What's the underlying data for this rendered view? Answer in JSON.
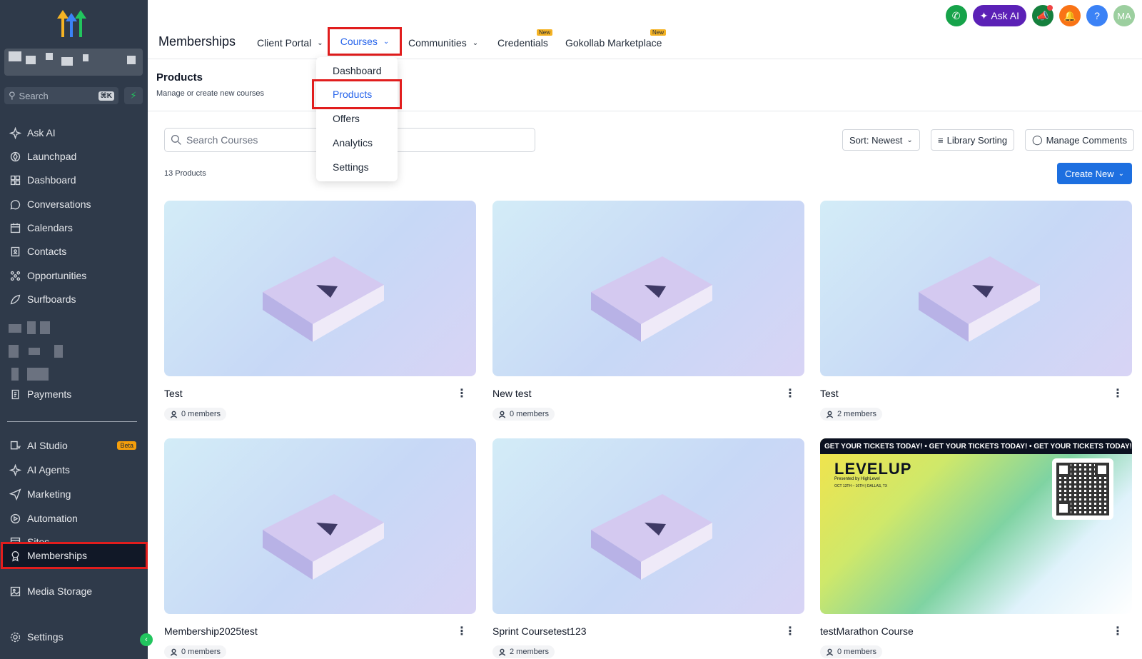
{
  "sidebar": {
    "search_placeholder": "Search",
    "search_shortcut": "⌘K",
    "items": [
      {
        "label": "Ask AI",
        "icon": "sparkle-icon"
      },
      {
        "label": "Launchpad",
        "icon": "rocket-icon"
      },
      {
        "label": "Dashboard",
        "icon": "grid-icon"
      },
      {
        "label": "Conversations",
        "icon": "chat-icon"
      },
      {
        "label": "Calendars",
        "icon": "calendar-icon"
      },
      {
        "label": "Contacts",
        "icon": "contacts-icon"
      },
      {
        "label": "Opportunities",
        "icon": "pipeline-icon"
      },
      {
        "label": "Surfboards",
        "icon": "surfboard-icon"
      },
      {
        "label": "Payments",
        "icon": "receipt-icon"
      },
      {
        "label": "AI Studio",
        "icon": "sparkle-icon",
        "badge": "Beta"
      },
      {
        "label": "AI Agents",
        "icon": "sparkle-icon"
      },
      {
        "label": "Marketing",
        "icon": "send-icon"
      },
      {
        "label": "Automation",
        "icon": "automation-icon"
      },
      {
        "label": "Sites",
        "icon": "sites-icon"
      },
      {
        "label": "Memberships",
        "icon": "award-icon"
      },
      {
        "label": "Media Storage",
        "icon": "image-icon"
      },
      {
        "label": "Settings",
        "icon": "gear-icon"
      }
    ]
  },
  "topbar": {
    "title": "Memberships",
    "tabs": [
      {
        "label": "Client Portal",
        "dropdown": true
      },
      {
        "label": "Courses",
        "dropdown": true
      },
      {
        "label": "Communities",
        "dropdown": true
      },
      {
        "label": "Credentials",
        "badge": "New"
      },
      {
        "label": "Gokollab Marketplace",
        "badge": "New"
      }
    ],
    "ask_ai": "Ask AI",
    "avatar_initials": "MA",
    "help": "?"
  },
  "dropdown": {
    "items": [
      "Dashboard",
      "Products",
      "Offers",
      "Analytics",
      "Settings"
    ],
    "active": "Products"
  },
  "page": {
    "title": "Products",
    "subtitle": "Manage or create new courses",
    "search_placeholder": "Search Courses",
    "sort_label": "Sort: Newest",
    "library_sorting": "Library Sorting",
    "manage_comments": "Manage Comments",
    "count": "13 Products",
    "create_new": "Create New"
  },
  "products": [
    {
      "title": "Test",
      "members": "0 members",
      "thumb": "book"
    },
    {
      "title": "New test",
      "members": "0 members",
      "thumb": "book"
    },
    {
      "title": "Test",
      "members": "2 members",
      "thumb": "book"
    },
    {
      "title": "Membership2025test",
      "members": "0 members",
      "thumb": "book"
    },
    {
      "title": "Sprint Coursetest123",
      "members": "2 members",
      "thumb": "book"
    },
    {
      "title": "testMarathon Course",
      "members": "0 members",
      "thumb": "levelup"
    }
  ],
  "promo": {
    "banner": "GET YOUR TICKETS TODAY! • GET YOUR TICKETS TODAY! • GET YOUR TICKETS TODAY!",
    "brand": "LEVELUP",
    "presented": "Presented by HighLevel",
    "date": "OCT 13TH – 16TH | DALLAS, TX"
  },
  "colors": {
    "accent": "#1d6fe0",
    "sidebar": "#2f3a4a",
    "highlight": "#e11d1d"
  }
}
